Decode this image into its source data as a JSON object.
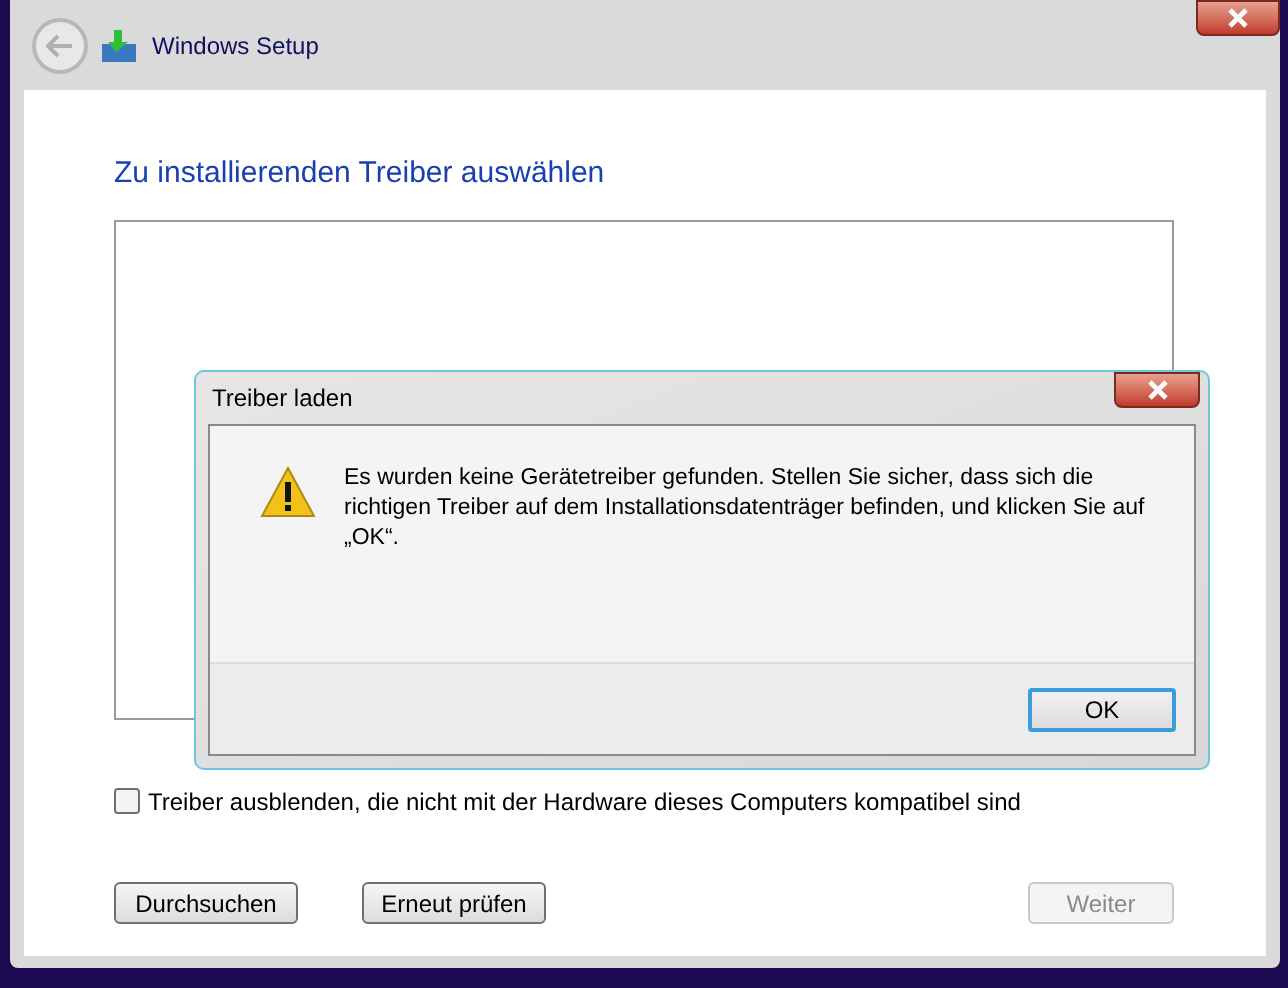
{
  "window": {
    "title": "Windows Setup"
  },
  "page": {
    "heading": "Zu installierenden Treiber auswählen"
  },
  "checkbox": {
    "label": "Treiber ausblenden, die nicht mit der Hardware dieses Computers kompatibel sind",
    "checked": false
  },
  "buttons": [
    {
      "label": "Durchsuchen",
      "disabled": false
    },
    {
      "label": "Erneut prüfen",
      "disabled": false
    },
    {
      "label": "Weiter",
      "disabled": true
    }
  ],
  "dialog": {
    "title": "Treiber laden",
    "message": "Es wurden keine Gerätetreiber gefunden. Stellen Sie sicher, dass sich die richtigen Treiber auf dem Installationsdatenträger befinden, und klicken Sie auf „OK“.",
    "button": "OK"
  }
}
